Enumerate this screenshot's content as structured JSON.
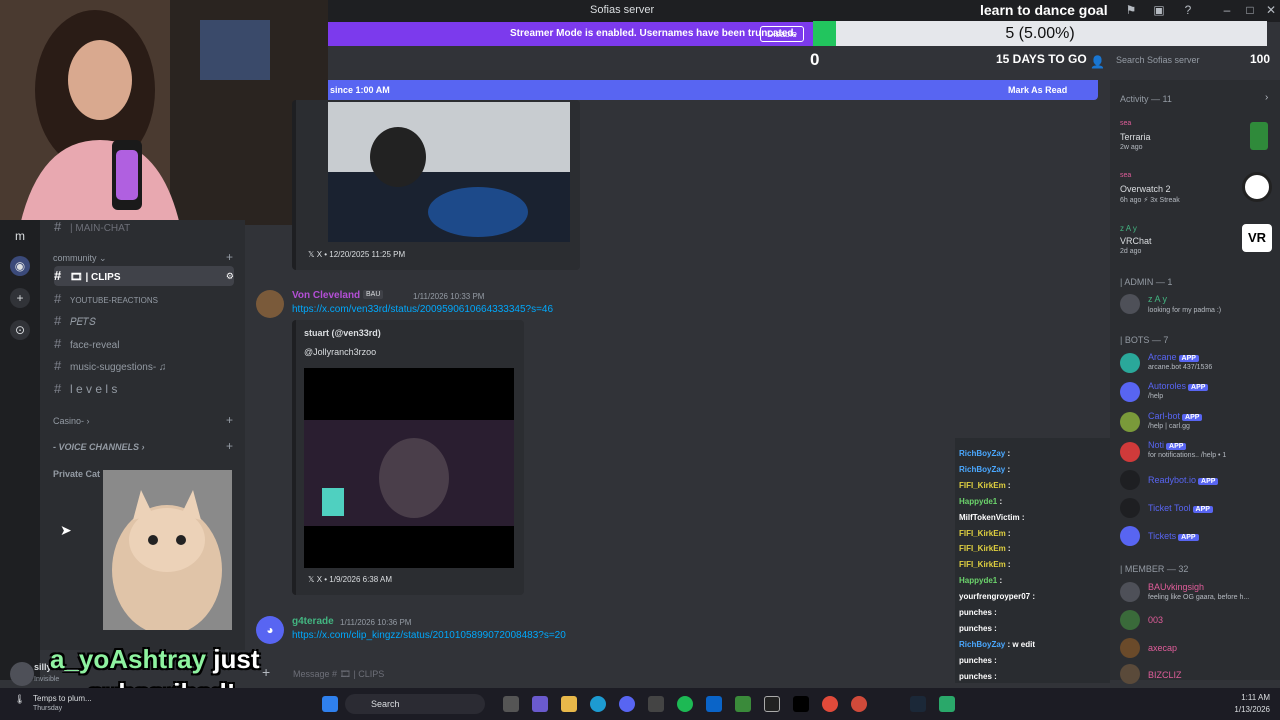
{
  "window": {
    "title": "Sofias server"
  },
  "streamer_banner": {
    "text": "Streamer Mode is enabled. Usernames have been truncated.",
    "disable_label": "Disable"
  },
  "goal": {
    "title": "learn to dance goal",
    "percent_label": "5 (5.00%)",
    "progress": 0.05,
    "min": "0",
    "max": "100",
    "days_left": "15 DAYS TO GO",
    "fill_color": "#22c55e"
  },
  "search": {
    "placeholder": "Search Sofias server"
  },
  "new_messages": {
    "since": "since 1:00 AM",
    "mark_read": "Mark As Read"
  },
  "sidebar": {
    "main_chat": "| MAIN-CHAT",
    "community_label": "community",
    "channels": [
      {
        "name": "| CLIPS",
        "active": true
      },
      {
        "name": "YOUTUBE-REACTIONS"
      },
      {
        "name": "𝑃𝐸𝑇𝑆"
      },
      {
        "name": "face-reveal"
      },
      {
        "name": "music-suggestions-"
      },
      {
        "name": "l e v e l s"
      }
    ],
    "casino_label": "Casino-",
    "voice_label": "- VOICE CHANNELS",
    "private_label": "Private Cat",
    "user": {
      "name": "silly",
      "status": "Invisible"
    }
  },
  "messages": [
    {
      "embed_footer": "X • 12/20/2025 11:25 PM"
    },
    {
      "author": "Von Cleveland",
      "tag": "BAU",
      "time": "1/11/2026 10:33 PM",
      "link": "https://x.com/ven33rd/status/2009590610664333345?s=46",
      "embed_author": "stuart (@ven33rd)",
      "embed_text": "@Jollyranch3rzoo",
      "embed_footer": "X • 1/9/2026 6:38 AM"
    },
    {
      "author": "g4terade",
      "time": "1/11/2026 10:36 PM",
      "link": "https://x.com/clip_kingzz/status/2010105899072008483?s=20"
    }
  ],
  "composer": {
    "placeholder": "Message # 🎞 | CLIPS"
  },
  "members": {
    "activity_header": "Activity — 11",
    "activities": [
      {
        "user": "sea",
        "game": "Terraria",
        "sub": "2w ago"
      },
      {
        "user": "sea",
        "game": "Overwatch 2",
        "sub": "6h ago  ⚡ 3x Streak"
      },
      {
        "user": "z A y",
        "game": "VRChat",
        "sub": "2d ago"
      }
    ],
    "admin_header": "| ADMIN — 1",
    "admin": {
      "name": "z A y",
      "status": "looking for my padma :)"
    },
    "bots_header": "| BOTS — 7",
    "bots": [
      {
        "name": "Arcane",
        "sub": "arcane.bot 437/1536",
        "badge": "APP"
      },
      {
        "name": "Autoroles",
        "sub": "/help",
        "badge": "APP"
      },
      {
        "name": "Carl-bot",
        "sub": "/help | carl.gg",
        "badge": "APP"
      },
      {
        "name": "Noti",
        "sub": "for notifications.. /help • 1",
        "badge": "APP"
      },
      {
        "name": "Readybot.io",
        "sub": "",
        "badge": "APP"
      },
      {
        "name": "Ticket Tool",
        "sub": "",
        "badge": "APP"
      },
      {
        "name": "Tickets",
        "sub": "",
        "badge": "APP"
      }
    ],
    "member_header": "| MEMBER — 32",
    "members": [
      {
        "name": "BAUvkingsigh",
        "sub": "feeling like OG gaara, before h..."
      },
      {
        "name": "003",
        "sub": ""
      },
      {
        "name": "axecap",
        "sub": ""
      },
      {
        "name": "BIZCLIZ",
        "sub": ""
      }
    ]
  },
  "chat_overlay": [
    {
      "name": "RichBoyZay",
      "msg": ""
    },
    {
      "name": "RichBoyZay",
      "msg": ""
    },
    {
      "name": "FIFI_KirkEm",
      "msg": ""
    },
    {
      "name": "Happyde1",
      "msg": ""
    },
    {
      "name": "MilfTokenVictim",
      "msg": ""
    },
    {
      "name": "FIFI_KirkEm",
      "msg": ""
    },
    {
      "name": "FIFI_KirkEm",
      "msg": ""
    },
    {
      "name": "FIFI_KirkEm",
      "msg": ""
    },
    {
      "name": "Happyde1",
      "msg": ""
    },
    {
      "name": "yourfrengroyper07",
      "msg": ""
    },
    {
      "name": "punches",
      "msg": ""
    },
    {
      "name": "punches",
      "msg": ""
    },
    {
      "name": "RichBoyZay",
      "msg": "w edit"
    },
    {
      "name": "punches",
      "msg": ""
    },
    {
      "name": "punches",
      "msg": ""
    }
  ],
  "subscribe_overlay": {
    "name": "a_yoAshtray",
    "line1_rest": " just",
    "line2": "subscribed!"
  },
  "taskbar": {
    "search_label": "Search",
    "weather": "Temps to plum...",
    "weather_sub": "Thursday",
    "time": "1:11 AM",
    "date": "1/13/2026"
  }
}
